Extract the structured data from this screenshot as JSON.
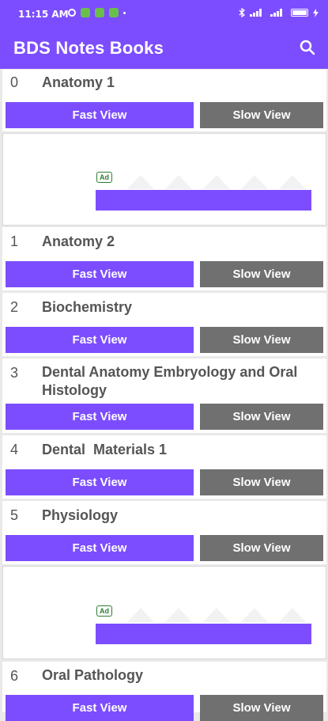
{
  "status_bar": {
    "time": "11:15 AM",
    "icons": [
      "alarm-icon",
      "app-notification-icon",
      "app-notification-icon",
      "app-notification-icon",
      "more-dot-icon"
    ],
    "right_icons": [
      "bluetooth-icon",
      "signal-icon",
      "signal-icon",
      "battery-icon",
      "charging-icon"
    ]
  },
  "app_bar": {
    "title": "BDS Notes Books",
    "search_icon": "search-icon"
  },
  "buttons": {
    "fast": "Fast View",
    "slow": "Slow View"
  },
  "items": [
    {
      "num": "0",
      "name": "Anatomy 1"
    },
    {
      "num": "1",
      "name": "Anatomy 2"
    },
    {
      "num": "2",
      "name": "Biochemistry"
    },
    {
      "num": "3",
      "name": "Dental Anatomy Embryology and Oral Histology"
    },
    {
      "num": "4",
      "name": "Dental  Materials 1"
    },
    {
      "num": "5",
      "name": "Physiology"
    },
    {
      "num": "6",
      "name": "Oral Pathology"
    }
  ],
  "ads": [
    {
      "badge": "Ad"
    },
    {
      "badge": "Ad"
    }
  ],
  "colors": {
    "primary": "#7c4dff",
    "slow_button": "#707070",
    "ad_badge": "#2e7d32"
  }
}
